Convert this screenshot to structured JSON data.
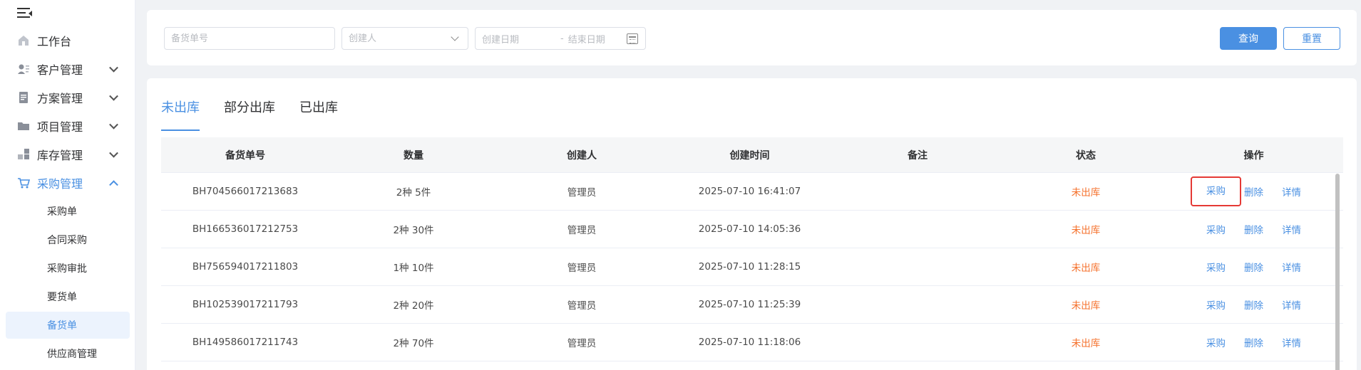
{
  "sidebar": {
    "menu": [
      {
        "label": "工作台",
        "icon": "home-icon"
      },
      {
        "label": "客户管理",
        "icon": "user-card-icon"
      },
      {
        "label": "方案管理",
        "icon": "document-icon"
      },
      {
        "label": "项目管理",
        "icon": "folder-icon"
      },
      {
        "label": "库存管理",
        "icon": "blocks-icon"
      },
      {
        "label": "采购管理",
        "icon": "cart-icon"
      }
    ],
    "sub_items": [
      "采购单",
      "合同采购",
      "采购审批",
      "要货单",
      "备货单",
      "供应商管理"
    ],
    "active_sub": "备货单"
  },
  "search": {
    "order_no_placeholder": "备货单号",
    "creator_placeholder": "创建人",
    "start_date_placeholder": "创建日期",
    "date_separator": "-",
    "end_date_placeholder": "结束日期",
    "query_label": "查询",
    "reset_label": "重置"
  },
  "tabs": [
    "未出库",
    "部分出库",
    "已出库"
  ],
  "active_tab": "未出库",
  "table": {
    "columns": [
      "备货单号",
      "数量",
      "创建人",
      "创建时间",
      "备注",
      "状态",
      "操作"
    ],
    "rows": [
      {
        "no": "BH704566017213683",
        "qty": "2种 5件",
        "creator": "管理员",
        "time": "2025-07-10 16:41:07",
        "note": "",
        "status": "未出库"
      },
      {
        "no": "BH166536017212753",
        "qty": "2种 30件",
        "creator": "管理员",
        "time": "2025-07-10 14:05:36",
        "note": "",
        "status": "未出库"
      },
      {
        "no": "BH756594017211803",
        "qty": "1种 10件",
        "creator": "管理员",
        "time": "2025-07-10 11:28:15",
        "note": "",
        "status": "未出库"
      },
      {
        "no": "BH102539017211793",
        "qty": "2种 20件",
        "creator": "管理员",
        "time": "2025-07-10 11:25:39",
        "note": "",
        "status": "未出库"
      },
      {
        "no": "BH149586017211743",
        "qty": "2种 70件",
        "creator": "管理员",
        "time": "2025-07-10 11:18:06",
        "note": "",
        "status": "未出库"
      }
    ],
    "actions": {
      "purchase": "采购",
      "delete": "删除",
      "detail": "详情"
    }
  },
  "colors": {
    "accent": "#4a90e2",
    "status_pending": "#f5712c",
    "highlight": "#e53935"
  }
}
